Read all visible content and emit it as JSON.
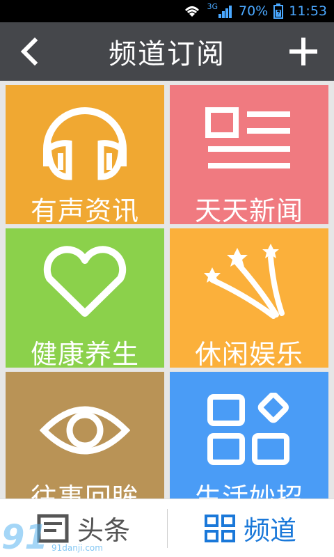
{
  "status_bar": {
    "network": "3G",
    "battery": "70%",
    "time": "11:53",
    "icons": [
      "wifi-icon",
      "signal-icon",
      "battery-icon"
    ]
  },
  "header": {
    "title": "频道订阅",
    "back_icon": "chevron-left-icon",
    "add_icon": "plus-icon"
  },
  "tiles": [
    {
      "label": "有声资讯",
      "icon": "headphones-icon",
      "color": "#f0a832"
    },
    {
      "label": "天天新闻",
      "icon": "news-icon",
      "color": "#f07a80"
    },
    {
      "label": "健康养生",
      "icon": "heart-icon",
      "color": "#8bd14b"
    },
    {
      "label": "休闲娱乐",
      "icon": "shooting-stars-icon",
      "color": "#fbb03b"
    },
    {
      "label": "往事回眸",
      "icon": "eye-icon",
      "color": "#b99356"
    },
    {
      "label": "生活妙招",
      "icon": "apps-grid-icon",
      "color": "#4a9cf6"
    }
  ],
  "bottom_nav": {
    "tabs": [
      {
        "label": "头条",
        "icon": "document-icon",
        "active": false
      },
      {
        "label": "频道",
        "icon": "grid-icon",
        "active": true
      }
    ]
  },
  "watermark": {
    "logo": "91",
    "site": "91danji.com"
  },
  "colors": {
    "header_bg": "#45474b",
    "active_tab": "#1a78d9",
    "status_accent": "#4aa8ff"
  }
}
